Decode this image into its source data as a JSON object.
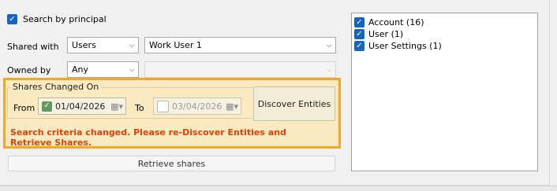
{
  "search_by_principal": {
    "label": "Search by principal",
    "checked": true
  },
  "shared_with": {
    "label": "Shared with",
    "type_value": "Users",
    "user_value": "Work User 1"
  },
  "owned_by": {
    "label": "Owned by",
    "value": "Any",
    "second_value": ""
  },
  "shares_changed": {
    "title": "Shares Changed On",
    "from_label": "From",
    "from_date": "01/04/2026",
    "from_checked": true,
    "to_label": "To",
    "to_date": "03/04/2026",
    "to_checked": false
  },
  "discover_button": "Discover Entities",
  "warning_text": "Search criteria changed. Please re-Discover Entities and Retrieve Shares.",
  "retrieve_button": "Retrieve shares",
  "entity_list": [
    {
      "label": "Account (16)",
      "checked": true
    },
    {
      "label": "User (1)",
      "checked": true
    },
    {
      "label": "User Settings (1)",
      "checked": true
    }
  ],
  "colors": {
    "highlight_border": "#f5a623",
    "highlight_fill": "#fbeac0",
    "warning": "#e0400b",
    "checkbox": "#1565c0"
  },
  "icons": {
    "check": "✓",
    "chevron": "⌵",
    "calendar": "calendar-icon"
  }
}
